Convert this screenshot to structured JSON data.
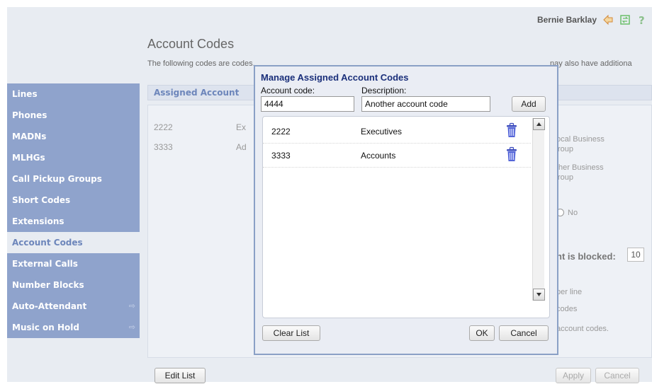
{
  "user": {
    "name": "Bernie Barklay",
    "icons": [
      "logout-icon",
      "refresh-icon",
      "help-icon"
    ]
  },
  "page": {
    "title": "Account Codes",
    "intro_left": "The following codes are codes.",
    "intro_right": "nay also have additiona"
  },
  "sidebar": {
    "items": [
      {
        "label": "Lines"
      },
      {
        "label": "Phones"
      },
      {
        "label": "MADNs"
      },
      {
        "label": "MLHGs"
      },
      {
        "label": "Call Pickup Groups"
      },
      {
        "label": "Short Codes"
      },
      {
        "label": "Extensions"
      },
      {
        "label": "Account Codes"
      },
      {
        "label": "External Calls"
      },
      {
        "label": "Number Blocks"
      },
      {
        "label": "Auto-Attendant"
      },
      {
        "label": "Music on Hold"
      }
    ],
    "arrow_glyph": "⇨"
  },
  "section": {
    "header": "Assigned Account"
  },
  "background_rows": [
    {
      "code": "2222",
      "desc": "Ex"
    },
    {
      "code": "3333",
      "desc": "Ad"
    }
  ],
  "background_right": {
    "local_business_1": "ocal Business",
    "local_business_2": "roup",
    "other_business_1": "ther Business",
    "other_business_2": "roup",
    "no_label": "No",
    "blocked_label": "nt is blocked:",
    "blocked_value": "10",
    "per_line": "per line",
    "codes": "codes",
    "account_codes": "account codes."
  },
  "footer": {
    "edit_list": "Edit List",
    "apply": "Apply",
    "cancel": "Cancel"
  },
  "dialog": {
    "title": "Manage Assigned Account Codes",
    "account_code_label": "Account code:",
    "account_code_value": "4444",
    "description_label": "Description:",
    "description_value": "Another account code",
    "add_button": "Add",
    "rows": [
      {
        "code": "2222",
        "description": "Executives"
      },
      {
        "code": "3333",
        "description": "Accounts"
      }
    ],
    "clear_list_button": "Clear List",
    "ok_button": "OK",
    "cancel_button": "Cancel"
  },
  "colors": {
    "sidebar": "#8fa3cc",
    "accent": "#1a2f7a",
    "dialog_border": "#8aa0c6"
  }
}
